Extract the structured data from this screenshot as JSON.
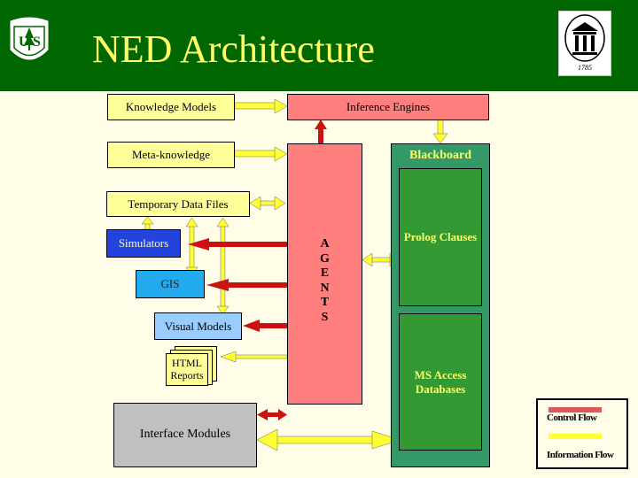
{
  "header": {
    "title": "NED Architecture",
    "left_logo": "forest-service-shield",
    "right_logo": "uga-arch-1785",
    "right_logo_year": "1785"
  },
  "colors": {
    "header_bg": "#006600",
    "title": "#ffff66",
    "control_flow": "#cc1111",
    "information_flow": "#ffff33"
  },
  "diagram": {
    "knowledge_models": "Knowledge Models",
    "inference_engines": "Inference Engines",
    "meta_knowledge": "Meta-knowledge",
    "blackboard": "Blackboard",
    "temporary_data_files": "Temporary Data Files",
    "simulators": "Simulators",
    "gis": "GIS",
    "visual_models": "Visual Models",
    "html_reports": "HTML Reports",
    "agents": "A\nG\nE\nN\nT\nS",
    "prolog_clauses": "Prolog Clauses",
    "ms_access_databases": "MS Access Databases",
    "interface_modules": "Interface Modules"
  },
  "legend": {
    "control_flow": "Control Flow",
    "information_flow": "Information Flow"
  }
}
